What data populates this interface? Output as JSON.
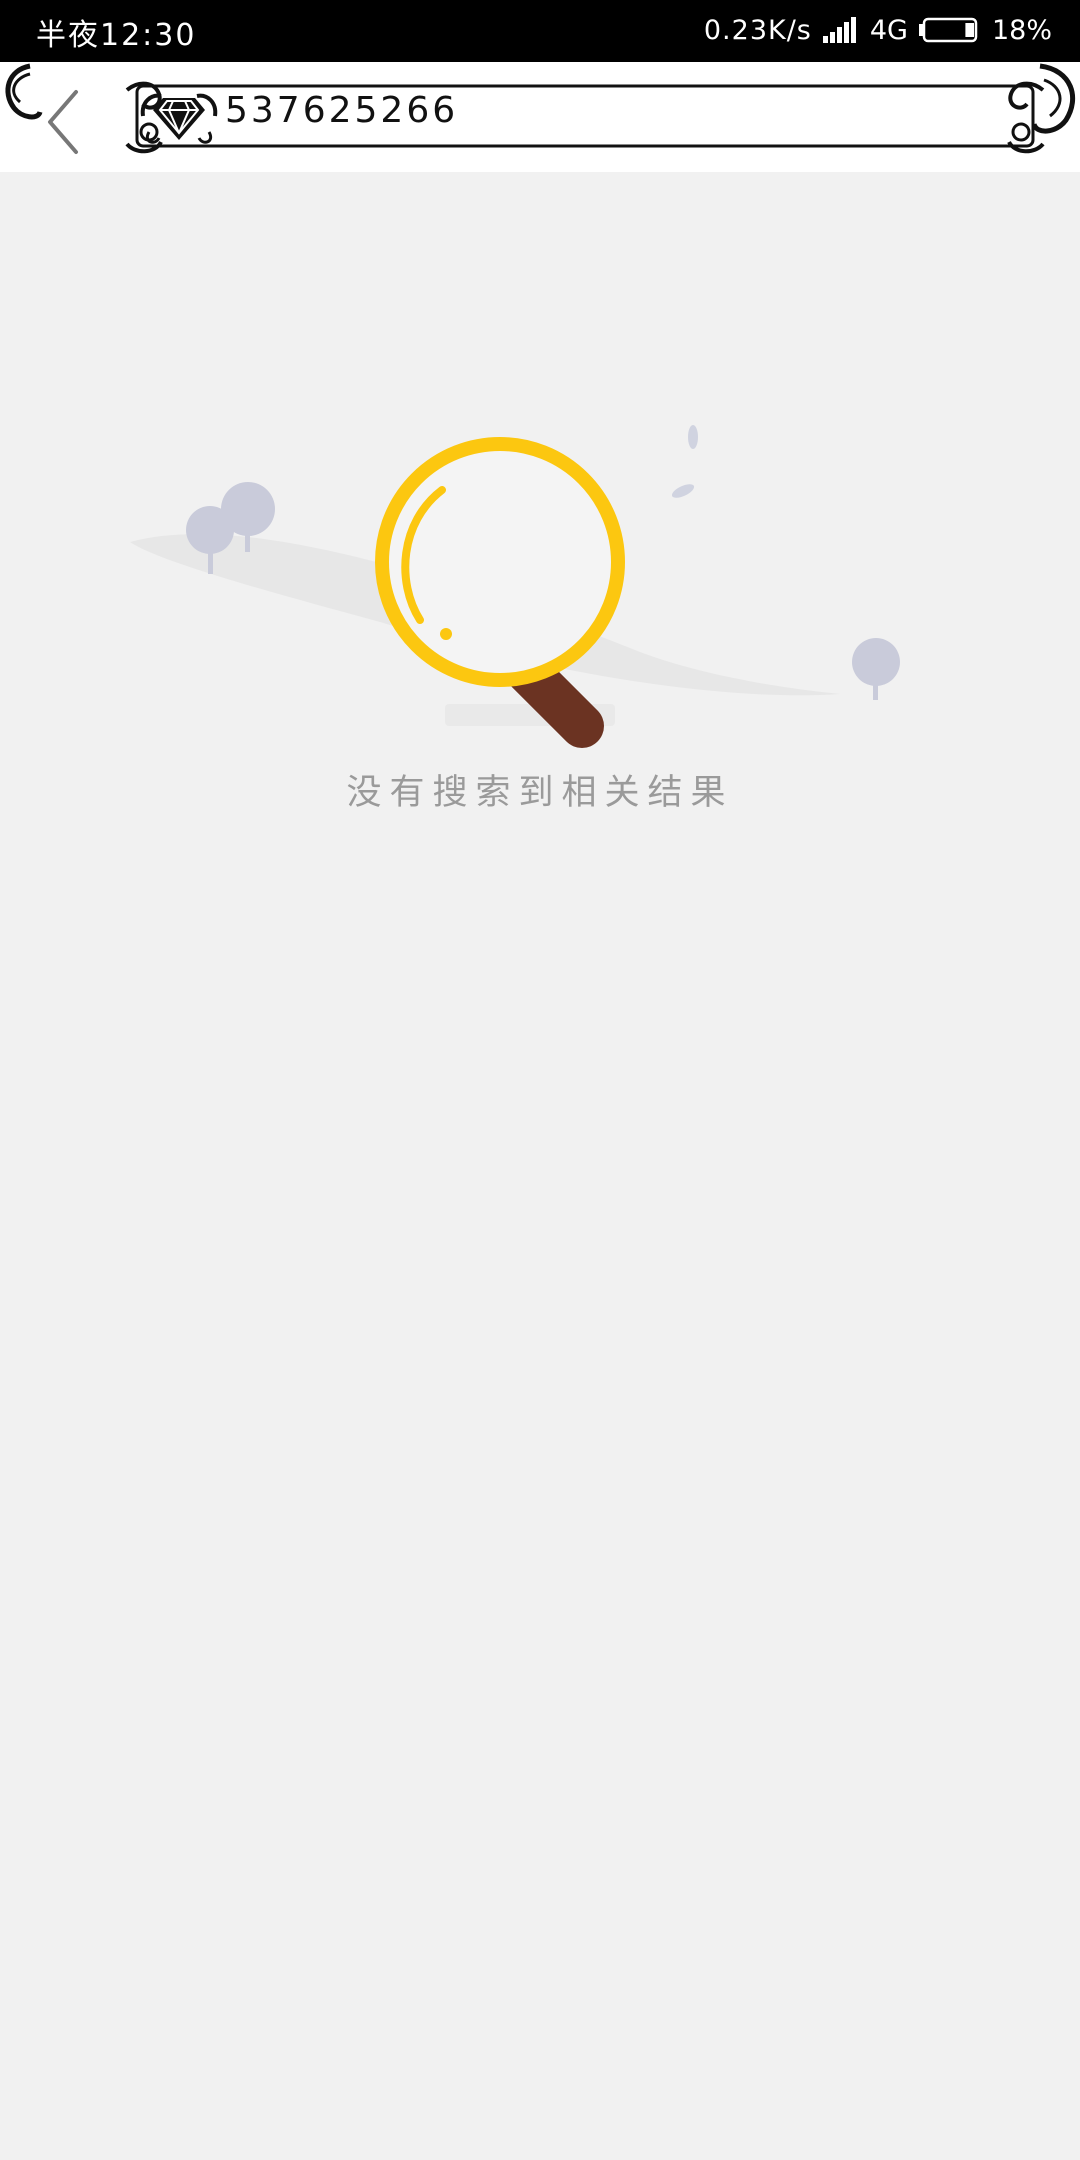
{
  "status_bar": {
    "time": "半夜12:30",
    "net_speed": "0.23K/s",
    "network_type": "4G",
    "battery_percent": "18%",
    "battery_level": 0.18,
    "signal_icon": "signal-bars-icon",
    "battery_icon": "battery-icon"
  },
  "header": {
    "back_icon": "chevron-left-icon",
    "search_icon": "diamond-icon",
    "search_value": "537625266"
  },
  "empty_state": {
    "illustration": "magnifying-glass-illustration",
    "message": "没有搜索到相关结果"
  },
  "colors": {
    "status_bar_bg": "#000000",
    "page_bg": "#f1f1f1",
    "magnifier_ring": "#fcc710",
    "magnifier_handle": "#6b3322",
    "empty_text": "#9a9a9a",
    "tree": "#c9cbda"
  }
}
